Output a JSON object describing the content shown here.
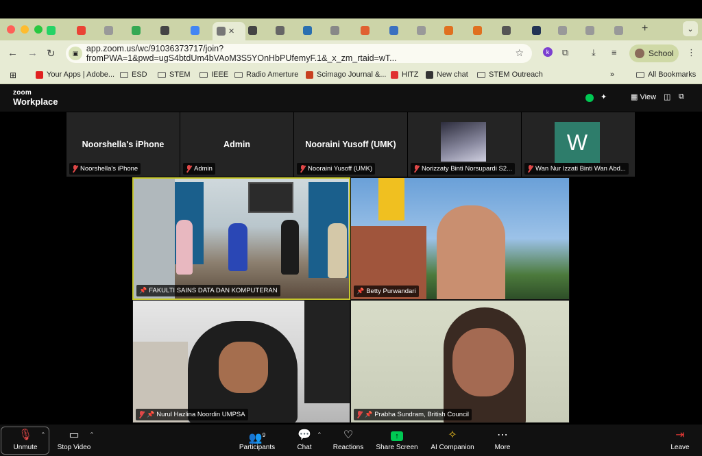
{
  "browser": {
    "tabs": [
      {
        "icon": "whatsapp-icon",
        "color": "#25d366"
      },
      {
        "icon": "gmail-icon",
        "color": "#ea4335"
      },
      {
        "icon": "globe-icon",
        "color": "#999999"
      },
      {
        "icon": "drive-icon",
        "color": "#34a853"
      },
      {
        "icon": "pkp-icon",
        "color": "#444444"
      },
      {
        "icon": "calendar-icon",
        "color": "#4285f4"
      },
      {
        "icon": "doc-icon",
        "color": "#777777"
      },
      {
        "icon": "chatgpt-icon",
        "color": "#444444"
      },
      {
        "icon": "photo-icon",
        "color": "#666666"
      },
      {
        "icon": "gear-icon",
        "color": "#2a6fb0"
      },
      {
        "icon": "doc-icon",
        "color": "#888888"
      },
      {
        "icon": "paper-icon",
        "color": "#e06030"
      },
      {
        "icon": "cube-icon",
        "color": "#3a70c0"
      },
      {
        "icon": "globe-icon",
        "color": "#999999"
      },
      {
        "icon": "elsevier-icon",
        "color": "#e07020"
      },
      {
        "icon": "elsevier-icon",
        "color": "#e07020"
      },
      {
        "icon": "mendeley-icon",
        "color": "#555555"
      },
      {
        "icon": "sn-icon",
        "color": "#223355"
      },
      {
        "icon": "globe-icon",
        "color": "#999999"
      },
      {
        "icon": "globe-icon",
        "color": "#999999"
      },
      {
        "icon": "globe-icon",
        "color": "#999999"
      }
    ],
    "url": "app.zoom.us/wc/91036373717/join?fromPWA=1&pwd=ugS4btdUm4bVAoM3S5YOnHbPUfemyF.1&_x_zm_rtaid=wT...",
    "profile_label": "School",
    "bookmarks": [
      {
        "label": "Your Apps | Adobe...",
        "icon": "adobe-icon"
      },
      {
        "label": "ESD",
        "icon": "folder-icon"
      },
      {
        "label": "STEM",
        "icon": "folder-icon"
      },
      {
        "label": "IEEE",
        "icon": "folder-icon"
      },
      {
        "label": "Radio Amerture",
        "icon": "folder-icon"
      },
      {
        "label": "Scimago Journal &...",
        "icon": "sjr-icon"
      },
      {
        "label": "HITZ",
        "icon": "hitz-icon"
      },
      {
        "label": "New chat",
        "icon": "chatgpt-icon"
      },
      {
        "label": "STEM Outreach",
        "icon": "folder-icon"
      }
    ],
    "all_bookmarks_label": "All Bookmarks"
  },
  "zoom": {
    "logo_top": "zoom",
    "logo_bottom": "Workplace",
    "view_label": "View",
    "top_tiles": [
      {
        "name": "Noorshella's iPhone",
        "label": "Noorshella's iPhone"
      },
      {
        "name": "Admin",
        "label": "Admin"
      },
      {
        "name": "Nooraini Yusoff (UMK)",
        "label": "Nooraini Yusoff (UMK)"
      },
      {
        "name": "",
        "label": "Norizzaty Binti Norsupardi S2..."
      },
      {
        "avatar_letter": "W",
        "label": "Wan Nur Izzati Binti Wan Abd..."
      }
    ],
    "videos": [
      {
        "label": "FAKULTI SAINS DATA DAN KOMPUTERAN"
      },
      {
        "label": "Betty Purwandari"
      },
      {
        "label": "Nurul Hazlina Noordin UMPSA"
      },
      {
        "label": "Prabha Sundram, British Council"
      }
    ],
    "controls": {
      "unmute": "Unmute",
      "stop_video": "Stop Video",
      "participants": "Participants",
      "participants_count": "9",
      "chat": "Chat",
      "reactions": "Reactions",
      "share_screen": "Share Screen",
      "ai_companion": "AI Companion",
      "more": "More",
      "leave": "Leave"
    },
    "accent_green": "#00c853",
    "leave_red": "#e53935"
  }
}
